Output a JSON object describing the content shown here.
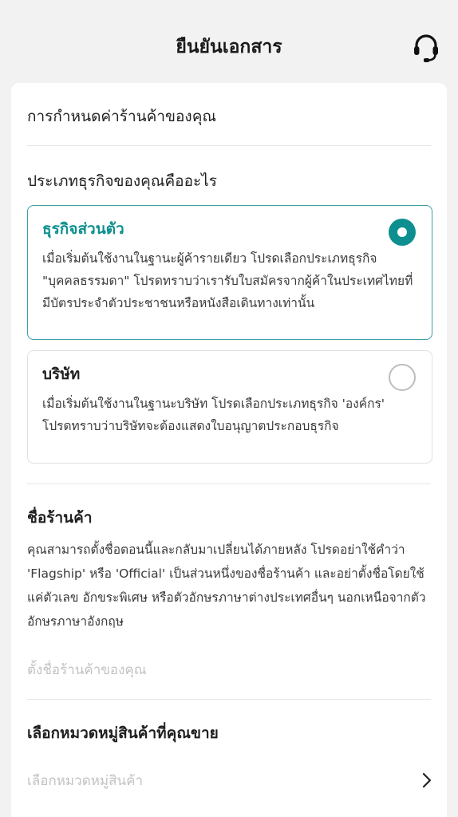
{
  "header": {
    "title": "ยืนยันเอกสาร",
    "support_icon": "headset-icon"
  },
  "store_settings": {
    "heading": "การกำหนดค่าร้านค้าของคุณ"
  },
  "business_type": {
    "question": "ประเภทธุรกิจของคุณคืออะไร",
    "options": [
      {
        "title": "ธุรกิจส่วนตัว",
        "description": "เมื่อเริ่มต้นใช้งานในฐานะผู้ค้ารายเดียว โปรดเลือกประเภทธุรกิจ \"บุคคลธรรมดา\" โปรดทราบว่าเรารับใบสมัครจากผู้ค้าในประเทศไทยที่มีบัตรประจำตัวประชาชนหรือหนังสือเดินทางเท่านั้น",
        "selected": true
      },
      {
        "title": "บริษัท",
        "description": "เมื่อเริ่มต้นใช้งานในฐานะบริษัท โปรดเลือกประเภทธุรกิจ 'องค์กร' โปรดทราบว่าบริษัทจะต้องแสดงใบอนุญาตประกอบธุรกิจ",
        "selected": false
      }
    ]
  },
  "shop_name": {
    "label": "ชื่อร้านค้า",
    "description": "คุณสามารถตั้งชื่อตอนนี้และกลับมาเปลี่ยนได้ภายหลัง โปรดอย่าใช้คำว่า 'Flagship' หรือ 'Official' เป็นส่วนหนึ่งของชื่อร้านค้า และอย่าตั้งชื่อโดยใช้แค่ตัวเลข อักขระพิเศษ หรือตัวอักษรภาษาต่างประเทศอื่นๆ นอกเหนือจากตัวอักษรภาษาอังกฤษ",
    "value": "",
    "placeholder": "ตั้งชื่อร้านค้าของคุณ"
  },
  "category": {
    "label": "เลือกหมวดหมู่สินค้าที่คุณขาย",
    "placeholder": "เลือกหมวดหมู่สินค้า",
    "icon": "chevron-right-icon"
  },
  "colors": {
    "accent": "#0e8f8f",
    "selected_border": "#3a9fa6",
    "placeholder": "#c2c2c2"
  }
}
